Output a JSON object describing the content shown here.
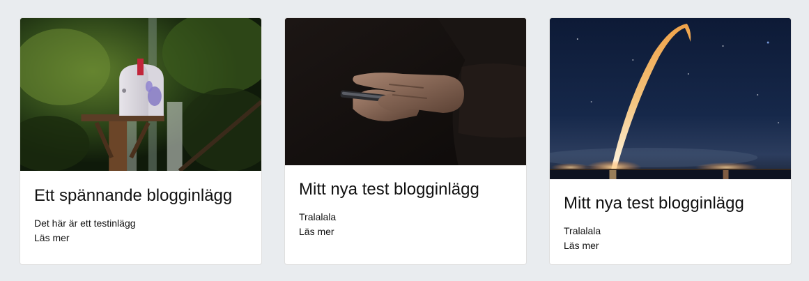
{
  "posts": [
    {
      "title": "Ett spännande blogginlägg",
      "excerpt": "Det här är ett testinlägg",
      "read_more": "Läs mer",
      "image": "mailbox-in-garden"
    },
    {
      "title": "Mitt nya test blogginlägg",
      "excerpt": "Tralalala",
      "read_more": "Läs mer",
      "image": "hands-holding-phone"
    },
    {
      "title": "Mitt nya test blogginlägg",
      "excerpt": "Tralalala",
      "read_more": "Läs mer",
      "image": "rocket-launch-night-sky"
    }
  ],
  "colors": {
    "page_background": "#e9ecef",
    "card_background": "#ffffff",
    "text": "#111111"
  }
}
